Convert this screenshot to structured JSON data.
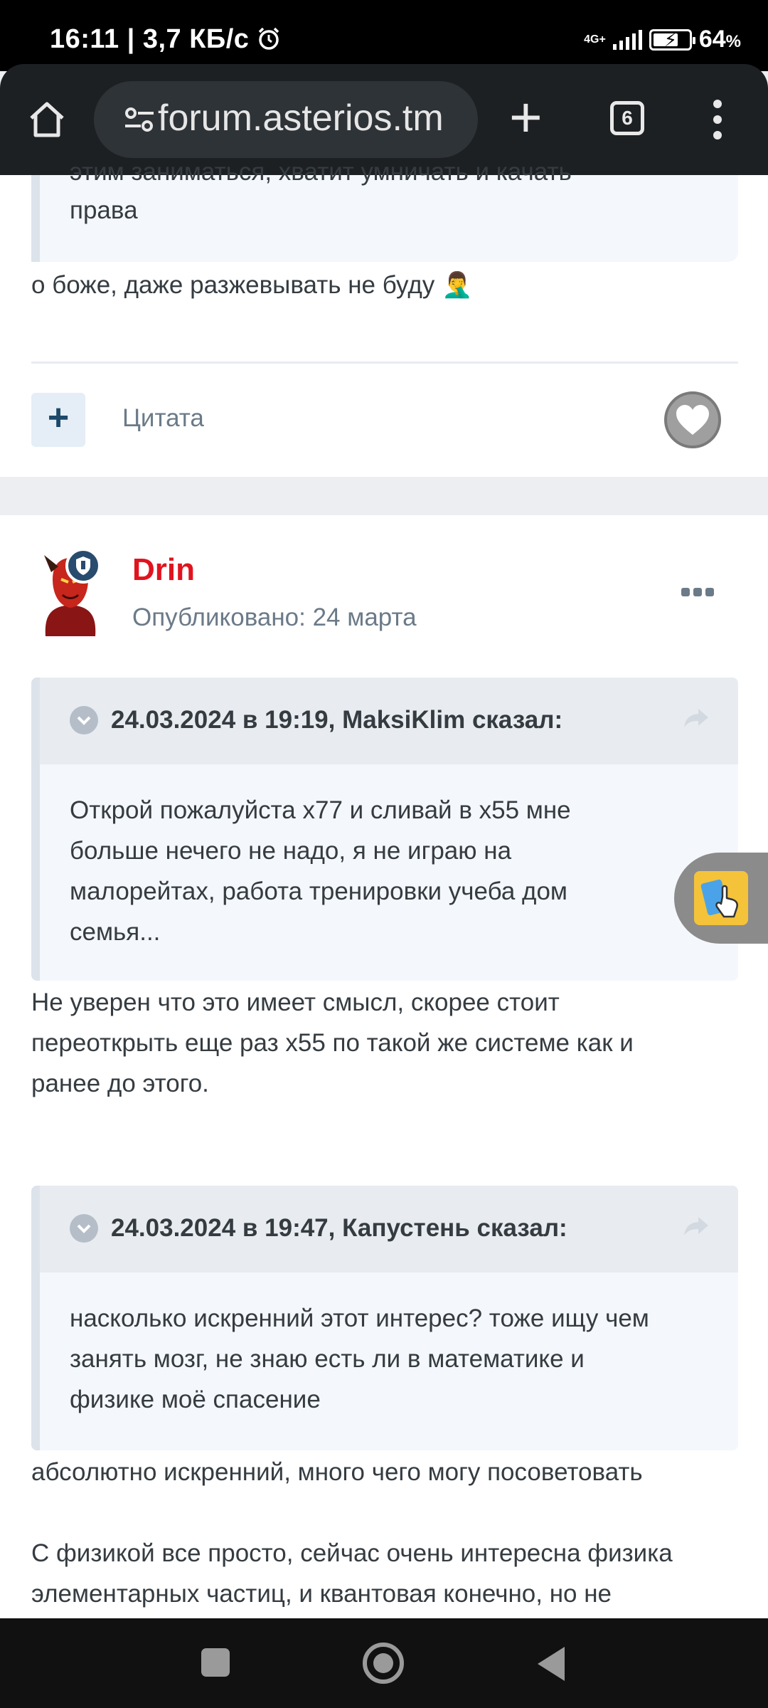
{
  "status_bar": {
    "time_speed": "16:11 | 3,7 КБ/с",
    "network": "4G+",
    "battery_percent": "64",
    "battery_sign": "%",
    "battery_level": 0.64
  },
  "browser": {
    "url": "forum.asterios.tm",
    "tab_count": "6"
  },
  "post1": {
    "quote_tail_clipped": "этим заниматься, хватит умничать и качать",
    "quote_tail_last": "права",
    "reply_text": "о боже, даже разжевывать не буду 🤦‍♂️",
    "add_label": "+",
    "quote_label": "Цитата"
  },
  "post2": {
    "author": "Drin",
    "published": "Опубликовано: 24 марта",
    "quote1": {
      "header": "24.03.2024 в 19:19, MaksiKlim сказал:",
      "lines": [
        "Открой пожалуйста x77 и сливай в x55 мне",
        "больше нечего не надо, я не играю на",
        "малорейтах, работа тренировки учеба дом",
        "семья..."
      ]
    },
    "reply1": [
      "Не уверен что это имеет смысл, скорее стоит",
      "переоткрыть еще раз x55 по такой же системе как и",
      "ранее до этого."
    ],
    "quote2": {
      "header": "24.03.2024 в 19:47, Капустень сказал:",
      "lines": [
        "насколько искренний этот интерес? тоже ищу чем",
        "занять мозг, не знаю есть ли в математике и",
        "физике моё спасение"
      ]
    },
    "reply2": "абсолютно искренний, много чего могу посоветовать",
    "reply3": [
      "С физикой все просто, сейчас очень интересна физика",
      "элементарных частиц, и квантовая конечно, но не"
    ]
  },
  "colors": {
    "author_name": "#e0141e",
    "quote_bg": "#f4f7fb",
    "quote_header_bg": "#e8ecf1",
    "quote_border": "#dce3ea"
  },
  "icons": {
    "home": "home-icon",
    "site_settings": "tune-icon",
    "new_tab": "plus-icon",
    "tabs": "tabs-icon",
    "menu": "more-vert-icon",
    "like": "heart-icon",
    "post_menu": "more-horiz-icon",
    "collapse": "chevron-down-icon",
    "share": "share-arrow-icon",
    "widget": "touch-hand-icon"
  }
}
